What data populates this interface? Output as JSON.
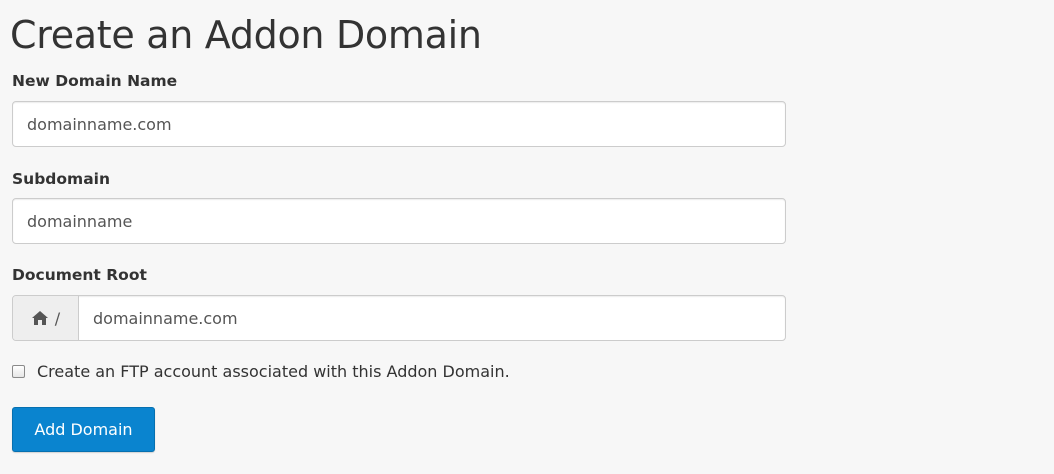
{
  "page_title": "Create an Addon Domain",
  "new_domain": {
    "label": "New Domain Name",
    "value": "domainname.com"
  },
  "subdomain": {
    "label": "Subdomain",
    "value": "domainname"
  },
  "document_root": {
    "label": "Document Root",
    "prefix_icon": "home-icon",
    "prefix_text": "/",
    "value": "domainname.com"
  },
  "ftp_option": {
    "label": "Create an FTP account associated with this Addon Domain.",
    "checked": false
  },
  "submit_button": {
    "label": "Add Domain"
  },
  "colors": {
    "background": "#f7f7f7",
    "button": "#0a84cf",
    "addon_background": "#eeeeee"
  }
}
